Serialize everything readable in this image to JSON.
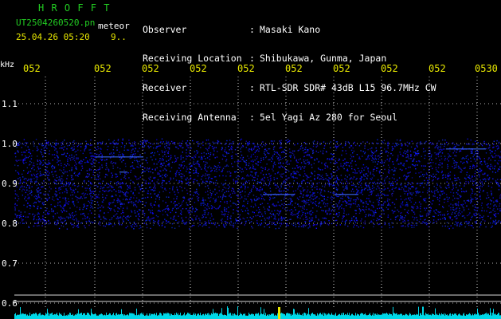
{
  "brand": "H R O F F T",
  "file": {
    "name": "UT2504260520.pn",
    "suffix": "meteor"
  },
  "capture": {
    "datetime": "25.04.26 05:20",
    "count": "9.."
  },
  "meta": {
    "labels": [
      "Observer",
      "Receiving Location",
      "Receiver",
      "Receiving Antenna"
    ],
    "colons": [
      ":",
      ":",
      ":",
      ":"
    ],
    "values": [
      "Masaki Kano",
      "Shibukawa, Gunma, Japan",
      "RTL-SDR SDR# 43dB L15 96.7MHz CW",
      "5el Yagi Az 280 for Seoul"
    ]
  },
  "axes": {
    "freq_unit": "kHz",
    "freq_ticks": [
      "1.1",
      "1.0",
      "0.9",
      "0.8",
      "0.7",
      "0.6"
    ],
    "time_ticks": [
      "052",
      "052",
      "052",
      "052",
      "052",
      "052",
      "052",
      "052",
      "052",
      "0530"
    ]
  },
  "colors": {
    "title_green": "#22cc22",
    "label_yellow": "#e8e800",
    "signal_blue": "#1a2fd8",
    "bar_cyan": "#00d8e8"
  }
}
